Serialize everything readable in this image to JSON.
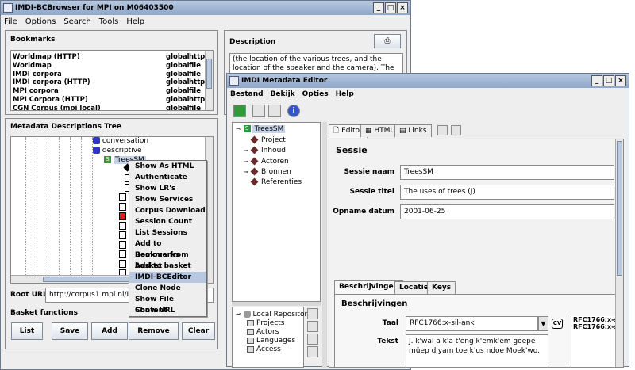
{
  "browser": {
    "title": "IMDI-BCBrowser for MPI on M06403500",
    "menu": [
      "File",
      "Options",
      "Search",
      "Tools",
      "Help"
    ],
    "bookmarks_label": "Bookmarks",
    "bookmarks": [
      {
        "name": "Worldmap (HTTP)",
        "scope": "global",
        "proto": "http"
      },
      {
        "name": "Worldmap",
        "scope": "global",
        "proto": "file"
      },
      {
        "name": "IMDI corpora",
        "scope": "global",
        "proto": "file"
      },
      {
        "name": "IMDI corpora (HTTP)",
        "scope": "global",
        "proto": "http"
      },
      {
        "name": "MPI corpora",
        "scope": "global",
        "proto": "file"
      },
      {
        "name": "MPI Corpora (HTTP)",
        "scope": "global",
        "proto": "http"
      },
      {
        "name": "CGN Corpus (mpi local)",
        "scope": "global",
        "proto": "file"
      }
    ],
    "description_label": "Description",
    "description_text": "(the location of the various trees, and the location of the speaker and the camera).  The idea for collecting this",
    "tree_label": "Metadata Descriptions Tree",
    "tree_nodes": {
      "conversation": "conversation",
      "descriptive": "descriptive",
      "treessm": "TreesSM"
    },
    "context_menu": [
      "Show As HTML",
      "Authenticate",
      "Show LR's",
      "Show Services",
      "Corpus Download",
      "Session Count",
      "List Sessions",
      "Add to Bookmarks",
      "Remove from basket",
      "Add to basket",
      "IMDI-BCEditor",
      "Clone Node",
      "Show File Content",
      "Show URL"
    ],
    "context_selected": "IMDI-BCEditor",
    "root_url_label": "Root URL",
    "root_url_value": "http://corpus1.mpi.nl/IMDI/m",
    "basket_label": "Basket functions",
    "basket_buttons": [
      "List",
      "Save",
      "Add",
      "Remove",
      "Clear"
    ]
  },
  "editor": {
    "title": "IMDI Metadata Editor",
    "menu": [
      "Bestand",
      "Bekijk",
      "Opties",
      "Help"
    ],
    "tree": {
      "root": "TreesSM",
      "children": [
        "Project",
        "Inhoud",
        "Actoren",
        "Bronnen",
        "Referenties"
      ]
    },
    "repo_tree": {
      "root": "Local Repository",
      "children": [
        "Projects",
        "Actors",
        "Languages",
        "Access"
      ]
    },
    "view_tabs": [
      "Editor",
      "HTML",
      "Links"
    ],
    "section_title": "Sessie",
    "fields": [
      {
        "label": "Sessie naam",
        "value": "TreesSM"
      },
      {
        "label": "Sessie titel",
        "value": "The uses of trees (J)"
      },
      {
        "label": "Opname datum",
        "value": "2001-06-25"
      }
    ],
    "sub_tabs": [
      "Beschrijvingen",
      "Locatie",
      "Keys"
    ],
    "sub_section_title": "Beschrijvingen",
    "taal_label": "Taal",
    "taal_value": "RFC1766:x-sil-ank",
    "cv_label": "CV",
    "tekst_label": "Tekst",
    "tekst_value": "J. k'wal a k'a t'eng k'emk'em goepe mûep d'yam toe k'us ndoe Moek'wo.",
    "side_list": [
      "RFC1766:x-s",
      "RFC1766:x-s"
    ]
  }
}
